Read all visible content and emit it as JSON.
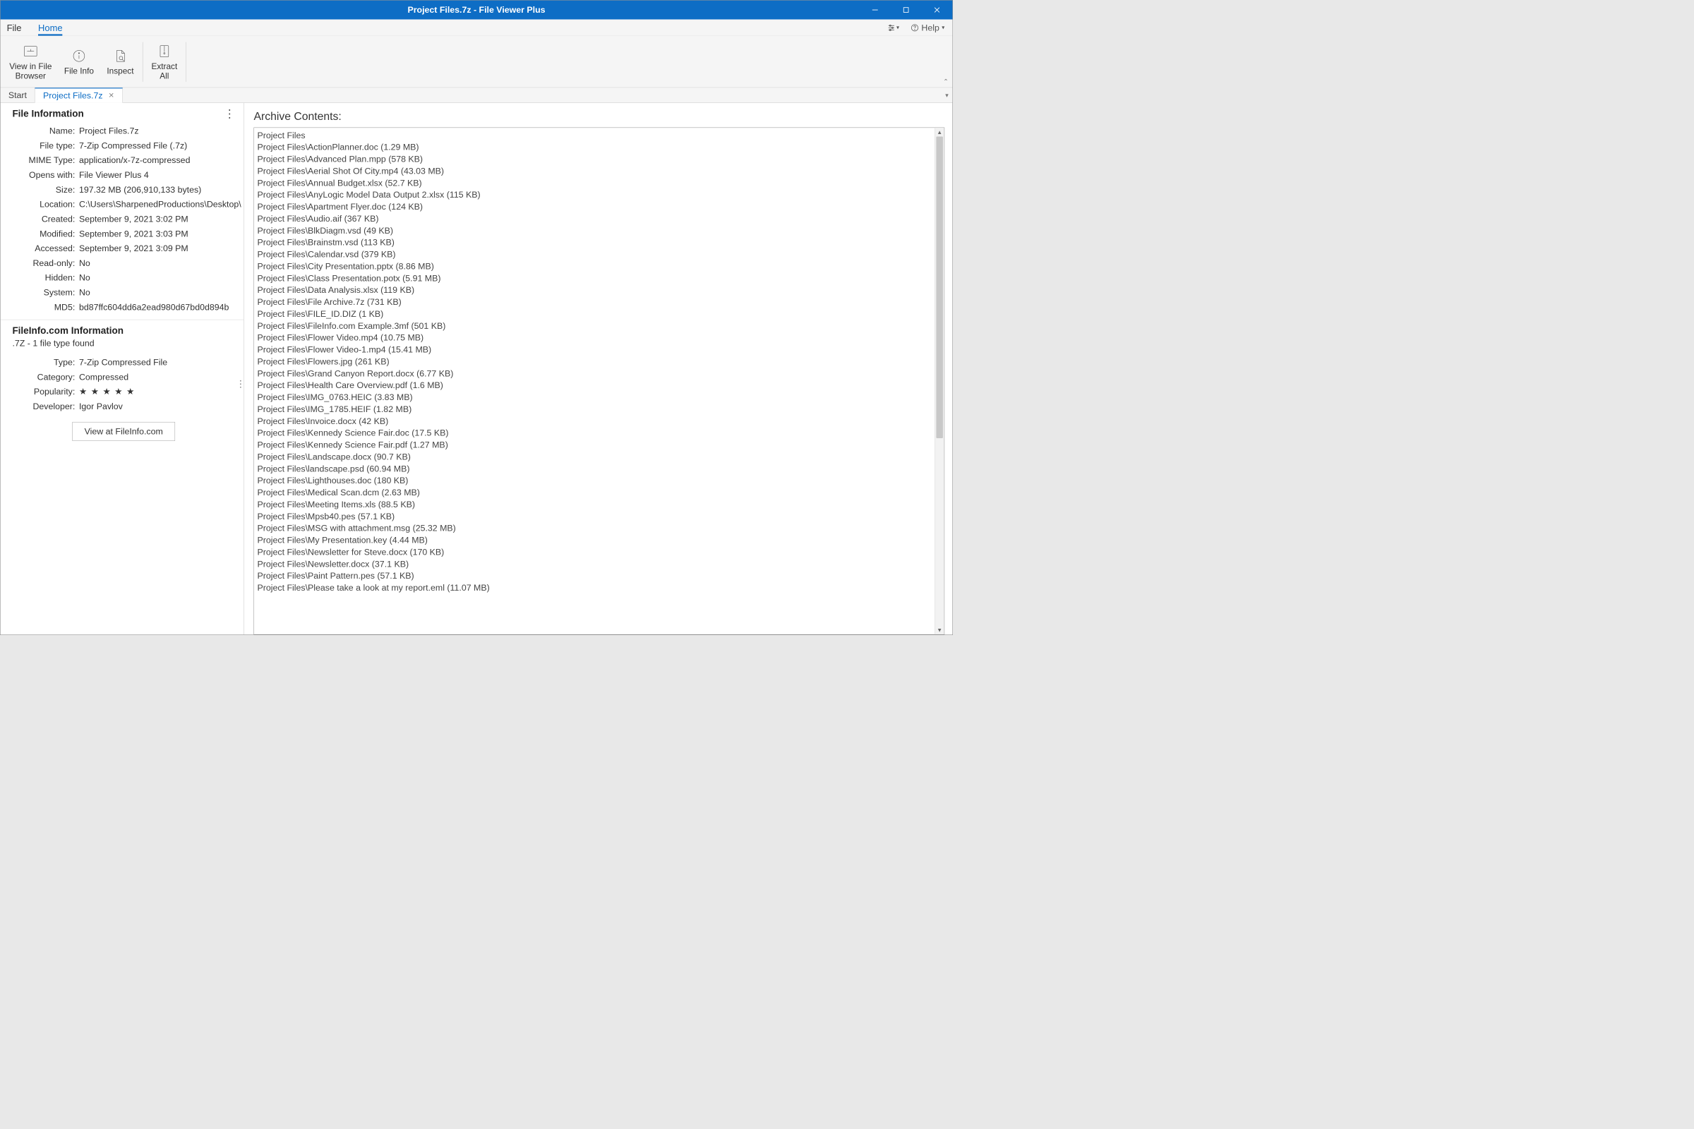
{
  "titlebar": {
    "title": "Project Files.7z - File Viewer Plus"
  },
  "menu": {
    "file": "File",
    "home": "Home",
    "help": "Help"
  },
  "ribbon": {
    "view_browser": "View in File\nBrowser",
    "file_info": "File Info",
    "inspect": "Inspect",
    "extract_all": "Extract\nAll"
  },
  "tabs": {
    "start": "Start",
    "current": "Project Files.7z"
  },
  "file_info": {
    "heading": "File Information",
    "rows": {
      "name_k": "Name:",
      "name_v": "Project Files.7z",
      "type_k": "File type:",
      "type_v": "7-Zip Compressed File (.7z)",
      "mime_k": "MIME Type:",
      "mime_v": "application/x-7z-compressed",
      "opens_k": "Opens with:",
      "opens_v": "File Viewer Plus 4",
      "size_k": "Size:",
      "size_v": "197.32 MB (206,910,133 bytes)",
      "loc_k": "Location:",
      "loc_v": "C:\\Users\\SharpenedProductions\\Desktop\\",
      "created_k": "Created:",
      "created_v": "September 9, 2021 3:02 PM",
      "modified_k": "Modified:",
      "modified_v": "September 9, 2021 3:03 PM",
      "accessed_k": "Accessed:",
      "accessed_v": "September 9, 2021 3:09 PM",
      "ro_k": "Read-only:",
      "ro_v": "No",
      "hidden_k": "Hidden:",
      "hidden_v": "No",
      "system_k": "System:",
      "system_v": "No",
      "md5_k": "MD5:",
      "md5_v": "bd87ffc604dd6a2ead980d67bd0d894b"
    }
  },
  "fi_info": {
    "heading": "FileInfo.com Information",
    "sub": ".7Z - 1 file type found",
    "rows": {
      "type_k": "Type:",
      "type_v": "7-Zip Compressed File",
      "cat_k": "Category:",
      "cat_v": "Compressed",
      "pop_k": "Popularity:",
      "pop_v": "★ ★ ★ ★ ★",
      "dev_k": "Developer:",
      "dev_v": "Igor Pavlov"
    },
    "button": "View at FileInfo.com"
  },
  "archive": {
    "heading": "Archive Contents:",
    "lines": [
      "Project Files",
      "Project Files\\ActionPlanner.doc (1.29 MB)",
      "Project Files\\Advanced Plan.mpp (578 KB)",
      "Project Files\\Aerial Shot Of City.mp4 (43.03 MB)",
      "Project Files\\Annual Budget.xlsx (52.7 KB)",
      "Project Files\\AnyLogic Model Data Output 2.xlsx (115 KB)",
      "Project Files\\Apartment Flyer.doc (124 KB)",
      "Project Files\\Audio.aif (367 KB)",
      "Project Files\\BlkDiagm.vsd (49 KB)",
      "Project Files\\Brainstm.vsd (113 KB)",
      "Project Files\\Calendar.vsd (379 KB)",
      "Project Files\\City Presentation.pptx (8.86 MB)",
      "Project Files\\Class Presentation.potx (5.91 MB)",
      "Project Files\\Data Analysis.xlsx (119 KB)",
      "Project Files\\File Archive.7z (731 KB)",
      "Project Files\\FILE_ID.DIZ (1 KB)",
      "Project Files\\FileInfo.com Example.3mf (501 KB)",
      "Project Files\\Flower Video.mp4 (10.75 MB)",
      "Project Files\\Flower Video-1.mp4 (15.41 MB)",
      "Project Files\\Flowers.jpg (261 KB)",
      "Project Files\\Grand Canyon Report.docx (6.77 KB)",
      "Project Files\\Health Care Overview.pdf (1.6 MB)",
      "Project Files\\IMG_0763.HEIC (3.83 MB)",
      "Project Files\\IMG_1785.HEIF (1.82 MB)",
      "Project Files\\Invoice.docx (42 KB)",
      "Project Files\\Kennedy Science Fair.doc (17.5 KB)",
      "Project Files\\Kennedy Science Fair.pdf (1.27 MB)",
      "Project Files\\Landscape.docx (90.7 KB)",
      "Project Files\\landscape.psd (60.94 MB)",
      "Project Files\\Lighthouses.doc (180 KB)",
      "Project Files\\Medical Scan.dcm (2.63 MB)",
      "Project Files\\Meeting Items.xls (88.5 KB)",
      "Project Files\\Mpsb40.pes (57.1 KB)",
      "Project Files\\MSG with attachment.msg (25.32 MB)",
      "Project Files\\My Presentation.key (4.44 MB)",
      "Project Files\\Newsletter for Steve.docx (170 KB)",
      "Project Files\\Newsletter.docx (37.1 KB)",
      "Project Files\\Paint Pattern.pes (57.1 KB)",
      "Project Files\\Please take a look at my report.eml (11.07 MB)"
    ]
  }
}
